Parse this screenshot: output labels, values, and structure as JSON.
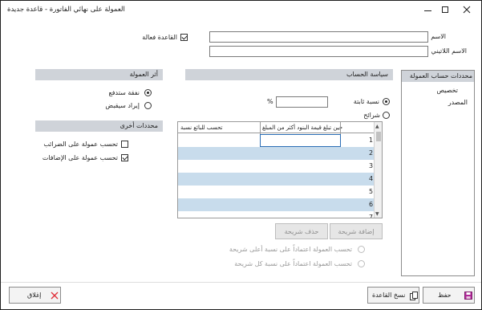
{
  "window": {
    "title": "العمولة على نهائي الفاتورة - قاعدة جديدة",
    "controls": {
      "minimize": "—",
      "maximize": "☐",
      "close": "✕"
    }
  },
  "form": {
    "name_label": "الاسم",
    "name_value": "",
    "latin_name_label": "الاسم اللاتيني",
    "latin_name_value": "",
    "active_rule_label": "القاعدة فعالة",
    "active_rule_checked": true
  },
  "sidebar": {
    "header": "محددات حساب العمولة",
    "items": [
      {
        "label": "تخصيص"
      },
      {
        "label": "المصدر"
      }
    ]
  },
  "calc_policy": {
    "header": "سياسة الحساب",
    "fixed_rate_label": "نسبة ثابتة",
    "fixed_rate_selected": true,
    "percent_sign": "%",
    "rate_value": "",
    "slices_label": "شرائح",
    "slices_selected": false
  },
  "slice_grid": {
    "columns": [
      {
        "label": "حين تبلغ قيمة البنود أكثر من المبلغ"
      },
      {
        "label": "تحسب للبائع نسبة"
      }
    ],
    "rows": [
      {
        "num": "1"
      },
      {
        "num": "2"
      },
      {
        "num": "3"
      },
      {
        "num": "4"
      },
      {
        "num": "5"
      },
      {
        "num": "6"
      },
      {
        "num": "7"
      }
    ]
  },
  "slice_buttons": {
    "add": "إضافة شريحة",
    "delete": "حذف شريحة"
  },
  "slice_options": {
    "highest": "تحسب العمولة اعتماداً على نسبة أعلى شريحة",
    "each": "تحسب العمولة اعتماداً على نسبة كل شريحة"
  },
  "commission_effect": {
    "header": "أثر العمولة",
    "payable_label": "نفقة ستدفع",
    "payable_selected": true,
    "receivable_label": "إيراد سيقبض",
    "receivable_selected": false
  },
  "other_params": {
    "header": "محددات أخرى",
    "taxes_label": "تحسب عمولة على الضرائب",
    "taxes_checked": false,
    "additions_label": "تحسب عمولة على الإضافات",
    "additions_checked": true
  },
  "footer": {
    "save": "حفظ",
    "copy_rule": "نسخ القاعدة",
    "close": "إغلاق"
  },
  "colors": {
    "section_header": "#cfd3d9",
    "grid_alt_row": "#c8dcec",
    "save_icon": "#b3289a",
    "close_icon": "#e0303a"
  }
}
